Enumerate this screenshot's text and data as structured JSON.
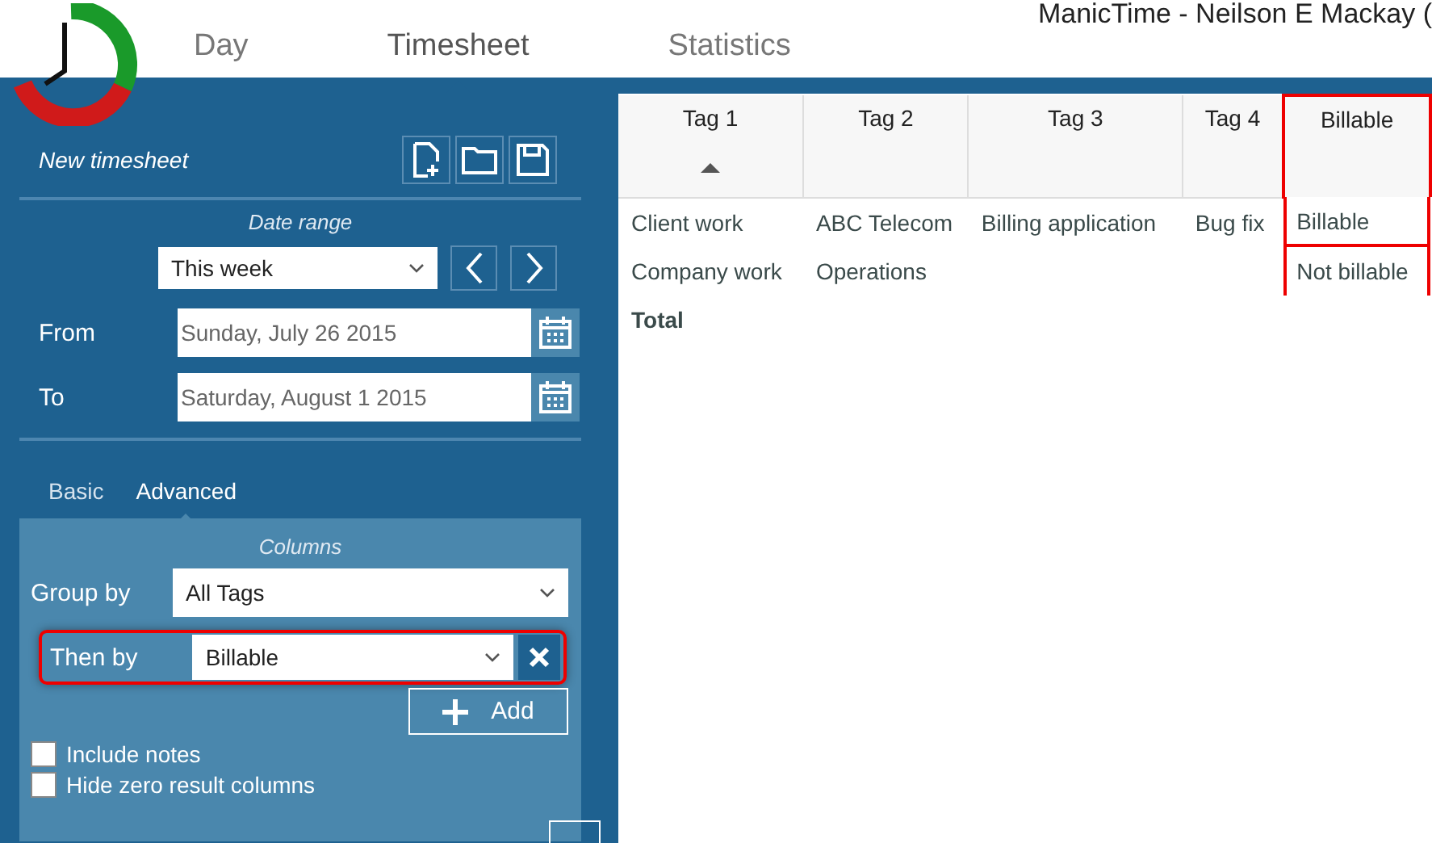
{
  "header": {
    "title": "ManicTime - Neilson E Mackay (",
    "tabs": [
      {
        "label": "Day",
        "selected": false
      },
      {
        "label": "Timesheet",
        "selected": true
      },
      {
        "label": "Statistics",
        "selected": false
      }
    ]
  },
  "sidebar": {
    "timesheet_name": "New timesheet",
    "date_range_label": "Date range",
    "range_select": "This week",
    "from_label": "From",
    "from_value": "Sunday, July 26 2015",
    "to_label": "To",
    "to_value": "Saturday, August 1 2015",
    "mode_tabs": [
      {
        "label": "Basic",
        "selected": false
      },
      {
        "label": "Advanced",
        "selected": true
      }
    ],
    "columns_label": "Columns",
    "group_by_label": "Group by",
    "group_by_value": "All Tags",
    "then_by": {
      "label": "Then by",
      "value": "Billable",
      "highlighted": true
    },
    "add_label": "Add",
    "checkboxes": [
      {
        "label": "Include notes",
        "checked": false
      },
      {
        "label": "Hide zero result columns",
        "checked": false
      }
    ]
  },
  "table": {
    "columns": [
      {
        "label": "Tag 1",
        "sorted": true,
        "highlighted": false
      },
      {
        "label": "Tag 2",
        "sorted": false,
        "highlighted": false
      },
      {
        "label": "Tag 3",
        "sorted": false,
        "highlighted": false
      },
      {
        "label": "Tag 4",
        "sorted": false,
        "highlighted": false
      },
      {
        "label": "Billable",
        "sorted": false,
        "highlighted": true
      }
    ],
    "rows": [
      {
        "kind": "data",
        "cells": [
          "Client work",
          "ABC Telecom",
          "Billing application",
          "Bug fix",
          "Billable"
        ]
      },
      {
        "kind": "data",
        "cells": [
          "Company work",
          "Operations",
          null,
          null,
          "Not billable"
        ]
      },
      {
        "kind": "total",
        "cells": [
          "Total",
          null,
          null,
          null,
          null
        ]
      }
    ]
  }
}
